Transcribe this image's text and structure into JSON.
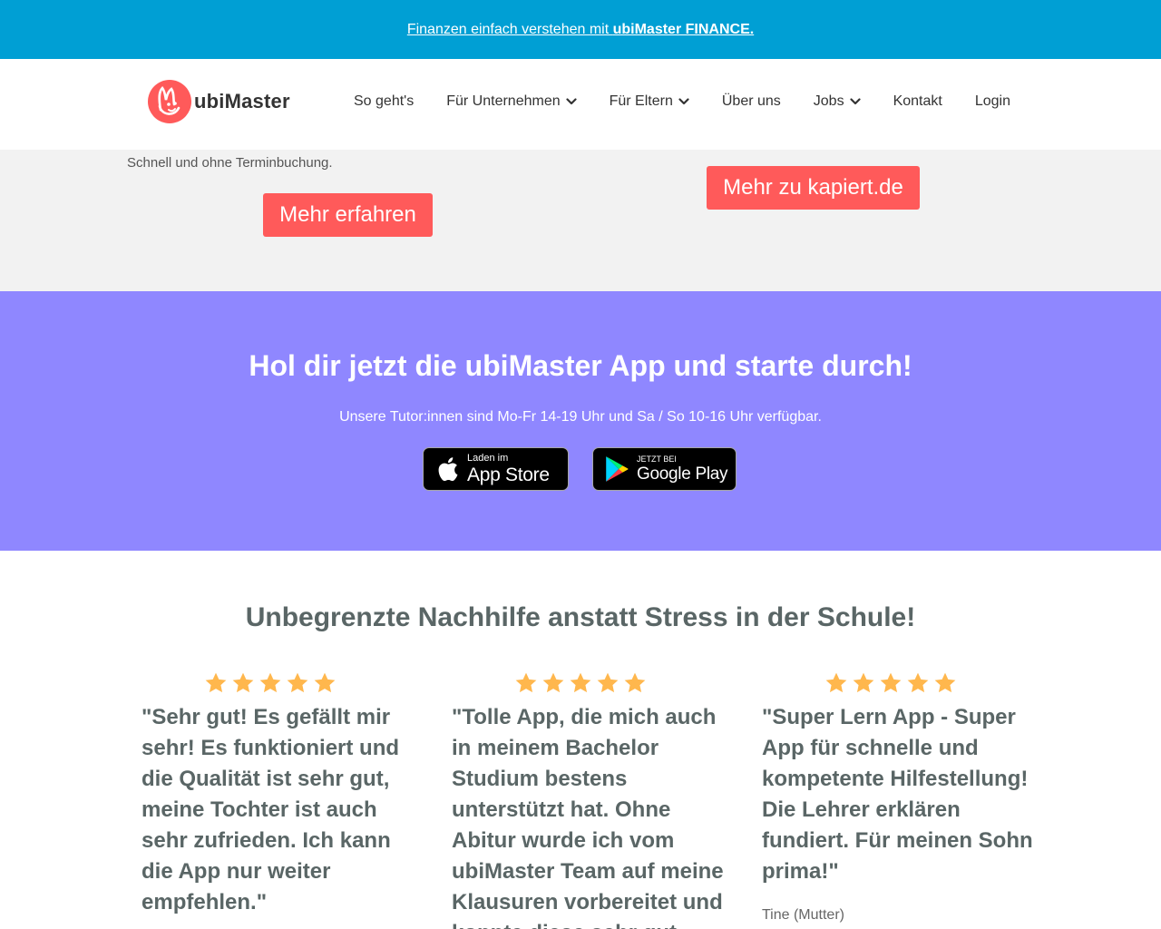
{
  "banner": {
    "text": "Finanzen einfach verstehen mit ",
    "strong": "ubiMaster FINANCE."
  },
  "nav": {
    "logo_text": "ubiMaster",
    "items": [
      {
        "label": "So geht's"
      },
      {
        "label": "Für Unternehmen"
      },
      {
        "label": "Für Eltern"
      },
      {
        "label": "Über uns"
      },
      {
        "label": "Jobs"
      },
      {
        "label": "Kontakt"
      },
      {
        "label": "Login"
      }
    ]
  },
  "promo": {
    "text": "Schnell und ohne Terminbuchung.",
    "button_left": "Mehr erfahren",
    "button_right": "Mehr zu kapiert.de"
  },
  "app": {
    "title": "Hol dir jetzt die ubiMaster App und starte durch!",
    "subtitle": "Unsere Tutor:innen sind Mo-Fr 14-19 Uhr und Sa / So 10-16 Uhr verfügbar.",
    "appstore_small": "Laden im",
    "appstore_big": "App Store",
    "playstore_small": "JETZT BEI",
    "playstore_big": "Google Play"
  },
  "reviews": {
    "title": "Unbegrenzte Nachhilfe anstatt Stress in der Schule!",
    "items": [
      {
        "rating": 5,
        "quote": "\"Sehr gut! Es gefällt mir sehr! Es funktioniert und die Qualität ist sehr gut, meine Tochter ist auch sehr zufrieden. Ich kann die App nur weiter empfehlen.\"",
        "author": ""
      },
      {
        "rating": 5,
        "quote": "\"Tolle App, die mich auch in meinem Bachelor Studium bestens unterstützt hat. Ohne Abitur wurde ich vom ubiMaster Team auf meine Klausuren vorbereitet und konnte diese sehr gut",
        "author": ""
      },
      {
        "rating": 5,
        "quote": "\"Super Lern App - Super App für schnelle und kompetente Hilfestellung! Die Lehrer erklären fundiert. Für meinen Sohn prima!\"",
        "author": "Tine (Mutter)"
      }
    ]
  },
  "colors": {
    "banner": "#009fd4",
    "accent_red": "#ff5a5a",
    "purple": "#8f87ff",
    "star": "#ffb74d"
  },
  "icons": [
    "ubimaster-logo-icon",
    "chevron-down-icon",
    "apple-icon",
    "google-play-icon",
    "star-icon"
  ]
}
